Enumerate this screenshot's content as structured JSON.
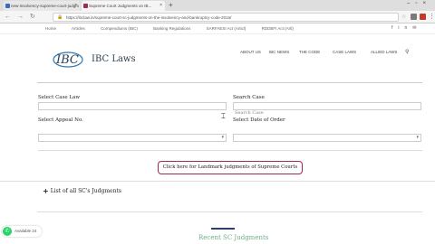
{
  "browser": {
    "tabs": [
      {
        "label": "new-insolvency-supreme-court-judgm"
      },
      {
        "label": "Supreme Court Judgments on IB..."
      }
    ],
    "url": "https://ibclaw.in/supreme-court-sc-judgments-on-the-insolvency-and-bankruptcy-code-2016/",
    "back_icon": "arrow-left",
    "forward_icon": "arrow-right",
    "reload_icon": "reload"
  },
  "topbar": {
    "crumbs": [
      "Home",
      "Articles",
      "Compendiums (IBC)",
      "Banking Regulations",
      "SARFAESI Act (Articl)",
      "RDDBFI Act (Artl)"
    ],
    "social": [
      "f",
      "in",
      "✉"
    ]
  },
  "header": {
    "logo_text": "IBC Laws",
    "nav": [
      "ABOUT US",
      "IBC NEWS",
      "THE CODE",
      "CASE LAWS",
      "ALLIED LAWS"
    ]
  },
  "form": {
    "case_law_label": "Select Case Law",
    "search_case_label": "Search Case",
    "search_case_placeholder": "Search Case",
    "appeal_label": "Select Appeal No.",
    "order_label": "Select Date of Order"
  },
  "landmark_button": "Click here for Landmark judgments of Supreme Courts",
  "sc_list": {
    "toggle": "+",
    "label": "List of all SC's Judgments"
  },
  "recent_heading": "Recent SC Judgments",
  "whatsapp": {
    "label": "Available 24"
  },
  "colors": {
    "accent": "#9b2b5a",
    "brand": "#2c3e50",
    "recent": "#6fb08a",
    "whatsapp": "#25d366"
  }
}
